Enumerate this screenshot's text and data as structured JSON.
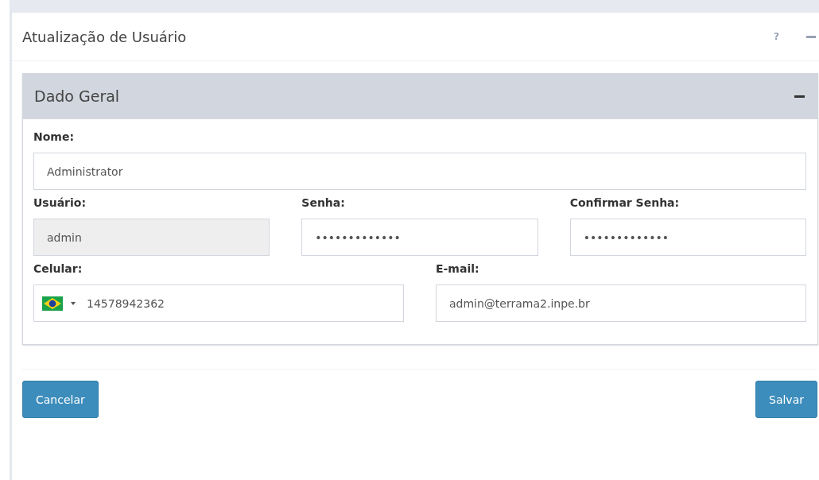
{
  "window": {
    "title": "Atualização de Usuário",
    "help_icon": "?"
  },
  "panel": {
    "title": "Dado Geral",
    "expanded": true
  },
  "rows": [
    [
      {
        "kind": "text",
        "label": "Nome:",
        "value": "Administrator",
        "disabled": false
      }
    ],
    [
      {
        "kind": "text",
        "label": "Usuário:",
        "value": "admin",
        "disabled": true
      },
      {
        "kind": "text",
        "label": "Senha:",
        "value": "•••••••••••••",
        "disabled": false
      },
      {
        "kind": "text",
        "label": "Confirmar Senha:",
        "value": "•••••••••••••",
        "disabled": false
      }
    ],
    [
      {
        "kind": "phone",
        "label": "Celular:",
        "value": "14578942362",
        "disabled": false
      },
      {
        "kind": "text",
        "label": "E-mail:",
        "value": "admin@terrama2.inpe.br",
        "disabled": false
      }
    ]
  ],
  "buttons": [
    {
      "label": "Cancelar"
    },
    {
      "label": "Salvar"
    }
  ]
}
